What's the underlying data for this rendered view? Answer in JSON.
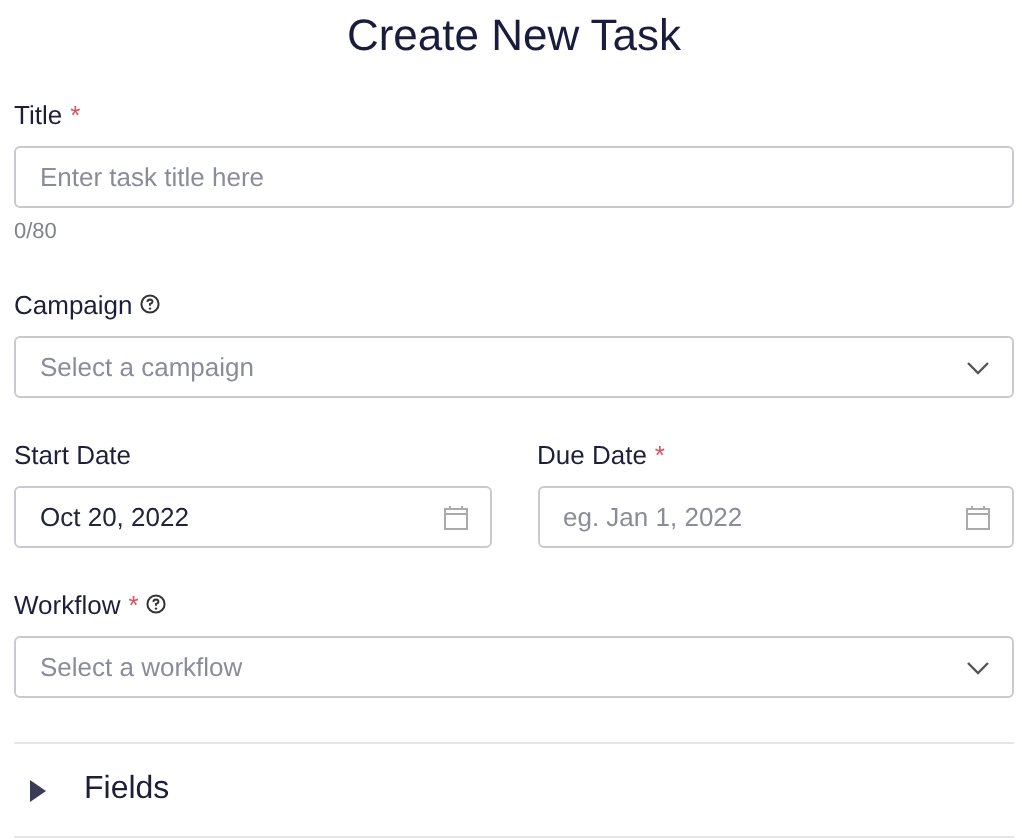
{
  "heading": "Create New Task",
  "required_mark": "*",
  "title_field": {
    "label": "Title",
    "required": true,
    "help": false,
    "placeholder": "Enter task title here",
    "counter": "0/80"
  },
  "campaign": {
    "label": "Campaign",
    "required": false,
    "help": true,
    "placeholder": "Select a campaign"
  },
  "start_date": {
    "label": "Start Date",
    "required": false,
    "help": false,
    "value": "Oct 20, 2022"
  },
  "due_date": {
    "label": "Due Date",
    "required": true,
    "help": false,
    "placeholder": "eg. Jan 1, 2022"
  },
  "workflow": {
    "label": "Workflow",
    "required": true,
    "help": true,
    "placeholder": "Select a workflow"
  },
  "fields_section": {
    "label": "Fields",
    "expanded": false
  }
}
